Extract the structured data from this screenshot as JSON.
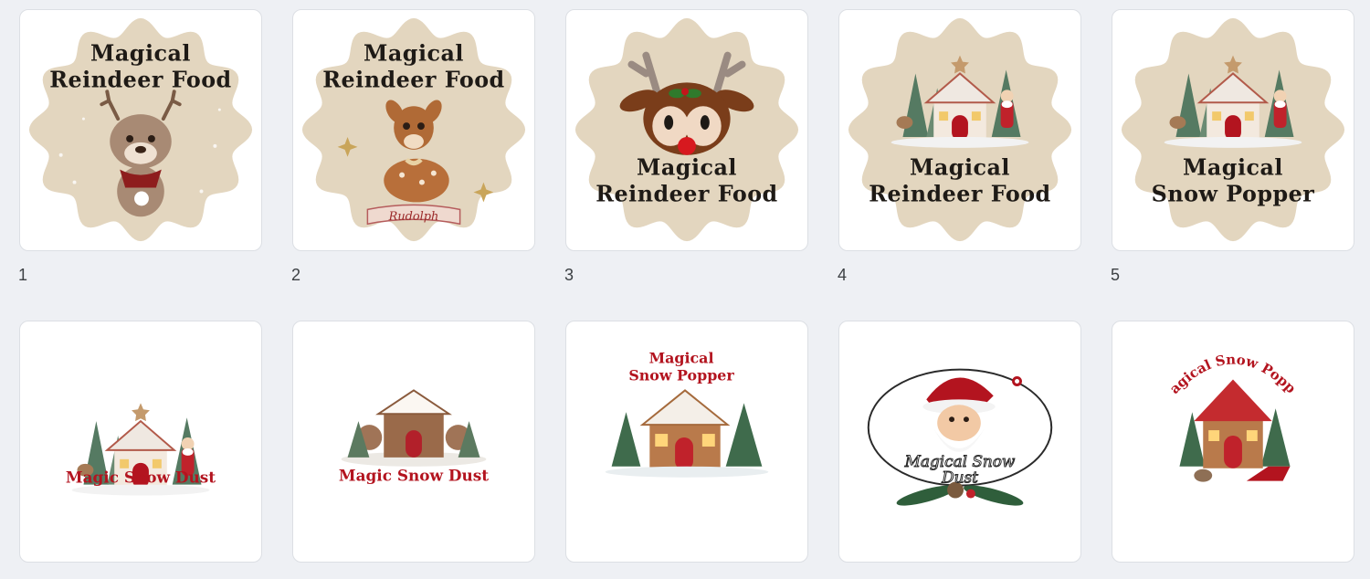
{
  "items": [
    {
      "number": "1",
      "line1": "Magical",
      "line2": "Reindeer Food"
    },
    {
      "number": "2",
      "line1": "Magical",
      "line2": "Reindeer Food",
      "banner": "Rudolph"
    },
    {
      "number": "3",
      "line1": "Magical",
      "line2": "Reindeer Food"
    },
    {
      "number": "4",
      "line1": "Magical",
      "line2": "Reindeer Food"
    },
    {
      "number": "5",
      "line1": "Magical",
      "line2": "Snow Popper"
    },
    {
      "caption": "Magic Snow Dust"
    },
    {
      "caption": "Magic Snow Dust"
    },
    {
      "line1": "Magical",
      "line2": "Snow Popper"
    },
    {
      "line1": "Magical Snow",
      "line2": "Dust"
    },
    {
      "caption": "Magical Snow Popper"
    }
  ],
  "colors": {
    "page_bg": "#eef0f4",
    "card_bg": "#ffffff",
    "parchment": "#e3d6bf",
    "title_dark": "#1e1a16",
    "title_red": "#b3141f"
  }
}
